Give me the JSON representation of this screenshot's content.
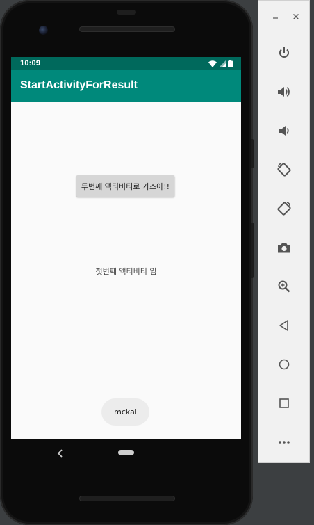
{
  "status_bar": {
    "time": "10:09",
    "icons": [
      "wifi-icon",
      "cell-signal-icon",
      "battery-icon"
    ],
    "color": "#00695c"
  },
  "app_bar": {
    "title": "StartActivityForResult",
    "color": "#00897b"
  },
  "main": {
    "button_label": "두번째 액티비티로 가즈아!!",
    "center_text": "첫번째 액티비티 임"
  },
  "toast": {
    "text": "mckal"
  },
  "nav_bar": {
    "icons": [
      "back-icon",
      "home-pill-icon"
    ]
  },
  "emulator_toolbar": {
    "window_controls": [
      "minimize-icon",
      "close-icon"
    ],
    "buttons": [
      "power-icon",
      "volume-up-icon",
      "volume-down-icon",
      "rotate-left-icon",
      "rotate-right-icon",
      "screenshot-icon",
      "zoom-icon",
      "back-icon",
      "home-icon",
      "overview-icon",
      "more-icon"
    ]
  }
}
